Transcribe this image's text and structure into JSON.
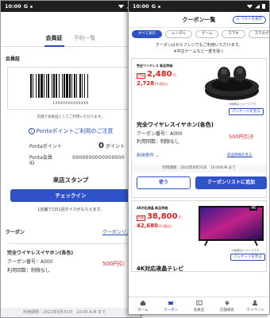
{
  "status_bar": {
    "time": "10:00",
    "carrier_icon": "G"
  },
  "left": {
    "tabs": [
      "会員証",
      "予約一覧"
    ],
    "member_label": "会員証",
    "barcode_number": "1XXXXXXXXXXXXX",
    "barcode_note": "店舗で会員証としてご利用いただけます。",
    "ponta_title": "Pontaポイントご利用のご注意",
    "ponta_points_label": "Pontaポイント",
    "ponta_points_value": "0",
    "ponta_points_unit": "ポイント",
    "ponta_id_label": "Ponta会員ID",
    "ponta_id_value": "0000000000000000",
    "stamp_title": "来店スタンプ",
    "checkin_label": "チェックイン",
    "stamp_note": "1店舗で1日1回ダイスがもらえます。",
    "coupon_heading": "クーポン",
    "coupon_list_link": "クーポンリストを",
    "coupon_title": "完全ワイヤレスイヤホン(各色)",
    "coupon_number": "クーポン番号：A000",
    "coupon_limit": "利用回数：制限なし",
    "coupon_discount": "500円引",
    "period_partial": "利用期限：2022年8月31日　10:00 A.M まで"
  },
  "right": {
    "header_title": "クーポン一覧",
    "list_button": "リストを表示",
    "chips": [
      "すべて表示",
      "レンタル",
      "ゲーム",
      "スマホ",
      "スマホグッズ"
    ],
    "notice_line1": "クーポンはセルフレジでもご利用いただけます。",
    "notice_line2": "※中古ゲームなど一部を除く",
    "card1": {
      "category": "完全ワイヤレス 新品特価",
      "price_tag": "特価",
      "price_main": "2,480",
      "price_main_unit": "円",
      "price_sub": "2,728",
      "price_sub_unit": "円",
      "tax_note": "(税込)",
      "image_note": "※画像はイメージです。",
      "package_button": "パッケージを見る",
      "product_name": "完全ワイヤレスイヤホン(各色)",
      "coupon_number": "クーポン番号：A000",
      "limit": "利用回数：制限なし",
      "discount": "500円引き",
      "terms": "利用条件",
      "detail_link": "商品情報を見る",
      "period": "利用期限：2022年8月31日　10:00A.M.まで",
      "use_button": "使う",
      "add_button": "クーポンリストに追加"
    },
    "card2": {
      "category": "4K対応液晶 新品特価",
      "price_tag": "特価",
      "price_main": "38,800",
      "price_main_unit": "円",
      "price_sub": "42,680",
      "price_sub_unit": "円",
      "tax_note": "(税込)",
      "image_note": "※画像はイメージです。",
      "package_button": "パッケージを見る",
      "product_name": "4K対応液晶テレビ",
      "badge": "4K"
    },
    "nav": [
      "ホーム",
      "クーポン",
      "会員証",
      "店舗検索",
      "マイページ"
    ]
  },
  "colors": {
    "accent": "#2f52c9",
    "price_red": "#e02020"
  }
}
